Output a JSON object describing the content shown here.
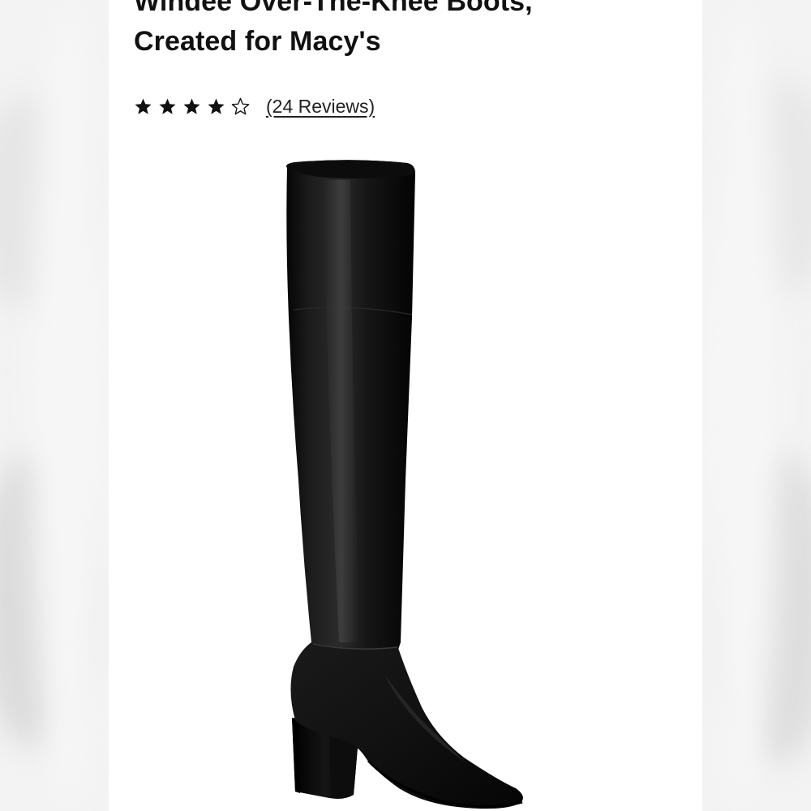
{
  "product": {
    "title_line_1": "Windee Over-The-Knee Boots,",
    "title_line_2": "Created for Macy's"
  },
  "rating": {
    "value": 4,
    "max": 5,
    "reviews_label": "(24 Reviews)"
  },
  "image": {
    "subject": "black over-the-knee block-heel boot",
    "color": "#111111"
  },
  "colors": {
    "panel_background": "#ffffff",
    "text": "#111111",
    "star": "#111111"
  },
  "icons": {
    "star_filled": "star-filled-icon",
    "star_empty": "star-outline-icon"
  }
}
